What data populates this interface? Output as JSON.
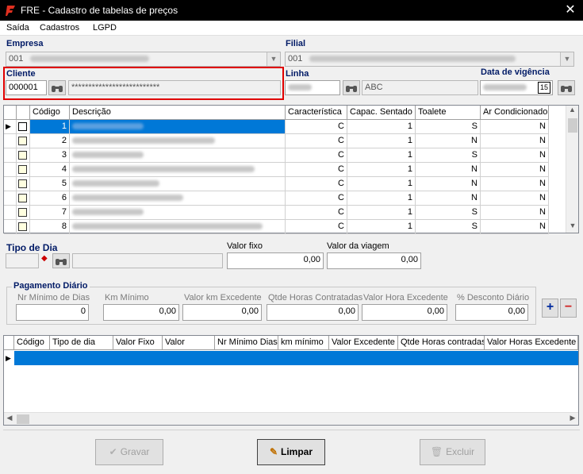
{
  "window": {
    "title": "FRE - Cadastro de tabelas de preços",
    "close_glyph": "✕"
  },
  "menu": [
    "Saída",
    "Cadastros",
    "LGPD"
  ],
  "empresa": {
    "label": "Empresa",
    "code": "001"
  },
  "filial": {
    "label": "Filial",
    "code": "001"
  },
  "cliente": {
    "label": "Cliente",
    "code": "000001",
    "name": "**************************"
  },
  "linha": {
    "label": "Linha",
    "value": "ABC"
  },
  "data_vigencia": {
    "label": "Data de vigência",
    "cal_label": "15"
  },
  "grid": {
    "headers": [
      "Código",
      "Descrição",
      "Característica",
      "Capac. Sentado",
      "Toalete",
      "Ar Condicionado"
    ],
    "rows": [
      {
        "codigo": "1",
        "car": "C",
        "cap": "1",
        "toalete": "S",
        "ar": "N"
      },
      {
        "codigo": "2",
        "car": "C",
        "cap": "1",
        "toalete": "N",
        "ar": "N"
      },
      {
        "codigo": "3",
        "car": "C",
        "cap": "1",
        "toalete": "S",
        "ar": "N"
      },
      {
        "codigo": "4",
        "car": "C",
        "cap": "1",
        "toalete": "N",
        "ar": "N"
      },
      {
        "codigo": "5",
        "car": "C",
        "cap": "1",
        "toalete": "N",
        "ar": "N"
      },
      {
        "codigo": "6",
        "car": "C",
        "cap": "1",
        "toalete": "N",
        "ar": "N"
      },
      {
        "codigo": "7",
        "car": "C",
        "cap": "1",
        "toalete": "S",
        "ar": "N"
      },
      {
        "codigo": "8",
        "car": "C",
        "cap": "1",
        "toalete": "S",
        "ar": "N"
      }
    ]
  },
  "tipo_dia": {
    "label": "Tipo de Dia"
  },
  "valor_fixo": {
    "label": "Valor fixo",
    "value": "0,00"
  },
  "valor_viagem": {
    "label": "Valor da viagem",
    "value": "0,00"
  },
  "pagamento": {
    "title": "Pagamento Diário",
    "fields": [
      {
        "label": "Nr Mínimo de Dias",
        "value": "0"
      },
      {
        "label": "Km Mínimo",
        "value": "0,00"
      },
      {
        "label": "Valor km Excedente",
        "value": "0,00"
      },
      {
        "label": "Qtde Horas Contratadas",
        "value": "0,00"
      },
      {
        "label": "Valor Hora Excedente",
        "value": "0,00"
      },
      {
        "label": "% Desconto Diário",
        "value": "0,00"
      }
    ],
    "add_glyph": "+",
    "remove_glyph": "−"
  },
  "grid2": {
    "headers": [
      "Código",
      "Tipo de dia",
      "Valor Fixo",
      "Valor",
      "Nr Mínimo Dias",
      "km mínimo",
      "Valor Excedente",
      "Qtde Horas contradas",
      "Valor Horas Excedente"
    ]
  },
  "buttons": {
    "gravar": "Gravar",
    "limpar": "Limpar",
    "excluir": "Excluir"
  },
  "colors": {
    "selection": "#0078d7",
    "highlight_frame": "#e00000",
    "label_blue": "#001a66"
  }
}
